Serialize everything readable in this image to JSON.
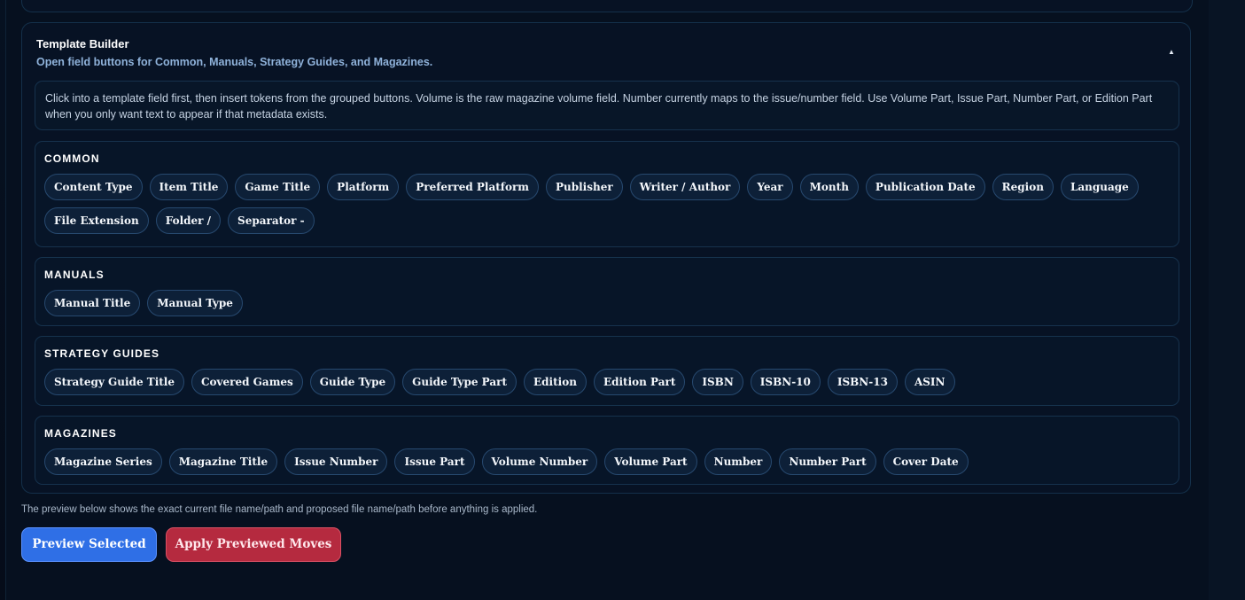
{
  "builder": {
    "title": "Template Builder",
    "subtitle": "Open field buttons for Common, Manuals, Strategy Guides, and Magazines.",
    "collapse_glyph": "▲"
  },
  "help_text": "Click into a template field first, then insert tokens from the grouped buttons. Volume is the raw magazine volume field. Number currently maps to the issue/number field. Use Volume Part, Issue Part, Number Part, or Edition Part when you only want text to appear if that metadata exists.",
  "groups": [
    {
      "title": "COMMON",
      "tokens": [
        "Content Type",
        "Item Title",
        "Game Title",
        "Platform",
        "Preferred Platform",
        "Publisher",
        "Writer / Author",
        "Year",
        "Month",
        "Publication Date",
        "Region",
        "Language",
        "File Extension",
        "Folder /",
        "Separator -"
      ]
    },
    {
      "title": "MANUALS",
      "tokens": [
        "Manual Title",
        "Manual Type"
      ]
    },
    {
      "title": "STRATEGY GUIDES",
      "tokens": [
        "Strategy Guide Title",
        "Covered Games",
        "Guide Type",
        "Guide Type Part",
        "Edition",
        "Edition Part",
        "ISBN",
        "ISBN-10",
        "ISBN-13",
        "ASIN"
      ]
    },
    {
      "title": "MAGAZINES",
      "tokens": [
        "Magazine Series",
        "Magazine Title",
        "Issue Number",
        "Issue Part",
        "Volume Number",
        "Volume Part",
        "Number",
        "Number Part",
        "Cover Date"
      ]
    }
  ],
  "preview_note": "The preview below shows the exact current file name/path and proposed file name/path before anything is applied.",
  "actions": {
    "preview_label": "Preview Selected",
    "apply_label": "Apply Previewed Moves"
  },
  "colors": {
    "primary": "#2f6fe6",
    "danger": "#b52a3f",
    "token_bg": "#0d2038"
  }
}
